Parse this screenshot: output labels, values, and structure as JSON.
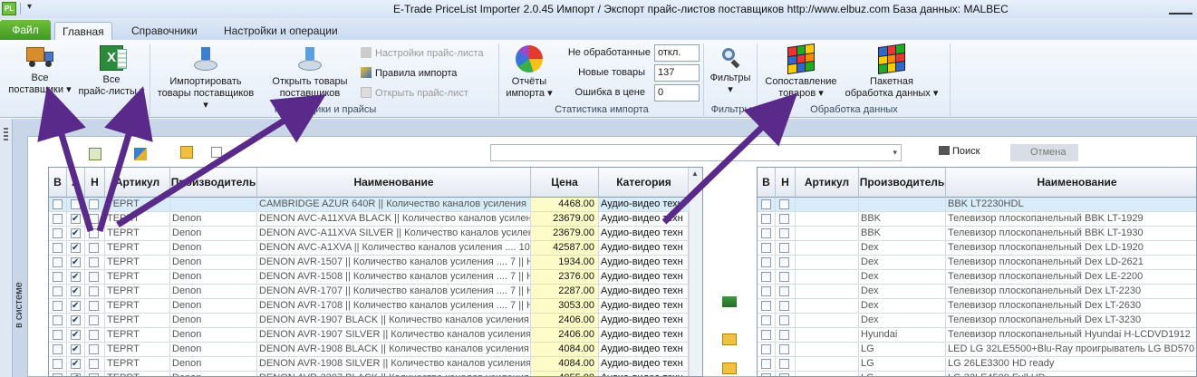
{
  "titlebar": {
    "app_icon": "PL",
    "title": "E-Trade PriceList Importer 2.0.45     Импорт / Экспорт прайс-листов поставщиков     http://www.elbuz.com     База данных: MALBEC"
  },
  "tabs": [
    "Файл",
    "Главная",
    "Справочники",
    "Настройки и операции"
  ],
  "ribbon": {
    "suppliers_group": {
      "label": "Поставщики и прайсы",
      "all_suppliers": [
        "Все",
        "поставщики"
      ],
      "all_pricelists": [
        "Все",
        "прайс-листы"
      ],
      "import_goods": [
        "Импортировать",
        "товары поставщиков"
      ],
      "open_goods": [
        "Открыть товары",
        "поставщиков"
      ],
      "pricelist_settings": "Настройки прайс-листа",
      "import_rules": "Правила импорта",
      "open_pricelist": "Открыть прайс-лист"
    },
    "stats_group": {
      "label": "Статистика импорта",
      "reports": [
        "Отчёты",
        "импорта"
      ],
      "not_processed_label": "Не обработанные",
      "not_processed_value": "откл.",
      "new_goods_label": "Новые товары",
      "new_goods_value": "137",
      "price_error_label": "Ошибка в цене",
      "price_error_value": "0"
    },
    "filters_group": {
      "label": "Фильтры",
      "filters": "Фильтры"
    },
    "data_group": {
      "label": "Обработка данных",
      "matching": [
        "Сопоставление",
        "товаров"
      ],
      "batch": [
        "Пакетная",
        "обработка данных"
      ]
    }
  },
  "toolbar": {
    "search_label": "Поиск",
    "cancel_label": "Отмена",
    "left_vertical": "в системе"
  },
  "colors": {
    "accent": "#5a2a8a",
    "file_tab": "#4fa82a",
    "price_bg": "#fdfbc8",
    "selected_row": "#d8ecfa"
  },
  "left_table": {
    "headers": [
      "В",
      "А",
      "Н",
      "Артикул",
      "Производитель",
      "Наименование",
      "Цена",
      "Категория"
    ],
    "rows": [
      {
        "v": false,
        "a": false,
        "n": false,
        "sku": "TEPRT",
        "maker": "",
        "name": "CAMBRIDGE AZUR 640R || Количество каналов усиления .... 7",
        "price": "4468.00",
        "cat": "Аудио-видео техн",
        "sel": true
      },
      {
        "v": false,
        "a": true,
        "n": false,
        "sku": "TEPRT",
        "maker": "Denon",
        "name": "DENON AVC-A11XVA BLACK || Количество каналов усиления .... 1",
        "price": "23679.00",
        "cat": "Аудио-видео техн",
        "sel": false
      },
      {
        "v": false,
        "a": true,
        "n": false,
        "sku": "TEPRT",
        "maker": "Denon",
        "name": "DENON AVC-A11XVA SILVER || Количество каналов усиления .... 1",
        "price": "23679.00",
        "cat": "Аудио-видео техн",
        "sel": false
      },
      {
        "v": false,
        "a": true,
        "n": false,
        "sku": "TEPRT",
        "maker": "Denon",
        "name": "DENON AVC-A1XVA || Количество каналов усиления .... 10 || Н",
        "price": "42587.00",
        "cat": "Аудио-видео техн",
        "sel": false
      },
      {
        "v": false,
        "a": true,
        "n": false,
        "sku": "TEPRT",
        "maker": "Denon",
        "name": "DENON AVR-1507 || Количество каналов усиления .... 7 || H",
        "price": "1934.00",
        "cat": "Аудио-видео техн",
        "sel": false
      },
      {
        "v": false,
        "a": true,
        "n": false,
        "sku": "TEPRT",
        "maker": "Denon",
        "name": "DENON AVR-1508 || Количество каналов усиления .... 7 || H",
        "price": "2376.00",
        "cat": "Аудио-видео техн",
        "sel": false
      },
      {
        "v": false,
        "a": true,
        "n": false,
        "sku": "TEPRT",
        "maker": "Denon",
        "name": "DENON AVR-1707 || Количество каналов усиления .... 7 || H",
        "price": "2287.00",
        "cat": "Аудио-видео техн",
        "sel": false
      },
      {
        "v": false,
        "a": true,
        "n": false,
        "sku": "TEPRT",
        "maker": "Denon",
        "name": "DENON AVR-1708 || Количество каналов усиления .... 7 || H",
        "price": "3053.00",
        "cat": "Аудио-видео техн",
        "sel": false
      },
      {
        "v": false,
        "a": true,
        "n": false,
        "sku": "TEPRT",
        "maker": "Denon",
        "name": "DENON AVR-1907 BLACK || Количество каналов усиления .... 7 ||",
        "price": "2406.00",
        "cat": "Аудио-видео техн",
        "sel": false
      },
      {
        "v": false,
        "a": true,
        "n": false,
        "sku": "TEPRT",
        "maker": "Denon",
        "name": "DENON AVR-1907 SILVER || Количество каналов усиления .... 7 ||",
        "price": "2406.00",
        "cat": "Аудио-видео техн",
        "sel": false
      },
      {
        "v": false,
        "a": true,
        "n": false,
        "sku": "TEPRT",
        "maker": "Denon",
        "name": "DENON AVR-1908 BLACK || Количество каналов усиления .... 7 ||",
        "price": "4084.00",
        "cat": "Аудио-видео техн",
        "sel": false
      },
      {
        "v": false,
        "a": true,
        "n": false,
        "sku": "TEPRT",
        "maker": "Denon",
        "name": "DENON AVR-1908 SILVER || Количество каналов усиления .... 7 ||",
        "price": "4084.00",
        "cat": "Аудио-видео техн",
        "sel": false
      },
      {
        "v": false,
        "a": true,
        "n": false,
        "sku": "TEPRT",
        "maker": "Denon",
        "name": "DENON AVR-2307 BLACK || Количество каналов усиления .... 7 ||",
        "price": "4055.00",
        "cat": "Аудио-видео техн",
        "sel": false
      }
    ]
  },
  "right_table": {
    "headers": [
      "В",
      "Н",
      "Артикул",
      "Производитель",
      "Наименование"
    ],
    "rows": [
      {
        "v": false,
        "n": false,
        "sku": "",
        "maker": "",
        "name": "BBK LT2230HDL",
        "sel": true
      },
      {
        "v": false,
        "n": false,
        "sku": "",
        "maker": "BBK",
        "name": "Телевизор плоскопанельный BBK LT-1929",
        "sel": false
      },
      {
        "v": false,
        "n": false,
        "sku": "",
        "maker": "BBK",
        "name": "Телевизор плоскопанельный BBK LT-1930",
        "sel": false
      },
      {
        "v": false,
        "n": false,
        "sku": "",
        "maker": "Dex",
        "name": "Телевизор плоскопанельный Dex LD-1920",
        "sel": false
      },
      {
        "v": false,
        "n": false,
        "sku": "",
        "maker": "Dex",
        "name": "Телевизор плоскопанельный Dex LD-2621",
        "sel": false
      },
      {
        "v": false,
        "n": false,
        "sku": "",
        "maker": "Dex",
        "name": "Телевизор плоскопанельный Dex LE-2200",
        "sel": false
      },
      {
        "v": false,
        "n": false,
        "sku": "",
        "maker": "Dex",
        "name": "Телевизор плоскопанельный Dex LT-2230",
        "sel": false
      },
      {
        "v": false,
        "n": false,
        "sku": "",
        "maker": "Dex",
        "name": "Телевизор плоскопанельный Dex LT-2630",
        "sel": false
      },
      {
        "v": false,
        "n": false,
        "sku": "",
        "maker": "Dex",
        "name": "Телевизор плоскопанельный Dex LT-3230",
        "sel": false
      },
      {
        "v": false,
        "n": false,
        "sku": "",
        "maker": "Hyundai",
        "name": "Телевизор плоскопанельный Hyundai H-LCDVD1912",
        "sel": false
      },
      {
        "v": false,
        "n": false,
        "sku": "",
        "maker": "LG",
        "name": "LED LG 32LE5500+Blu-Ray проигрыватель LG BD570 (Ak",
        "sel": false
      },
      {
        "v": false,
        "n": false,
        "sku": "",
        "maker": "LG",
        "name": "LG 26LE3300 HD ready",
        "sel": false
      },
      {
        "v": false,
        "n": false,
        "sku": "",
        "maker": "LG",
        "name": "LG 32LE4500 Full HD",
        "sel": false
      }
    ]
  }
}
